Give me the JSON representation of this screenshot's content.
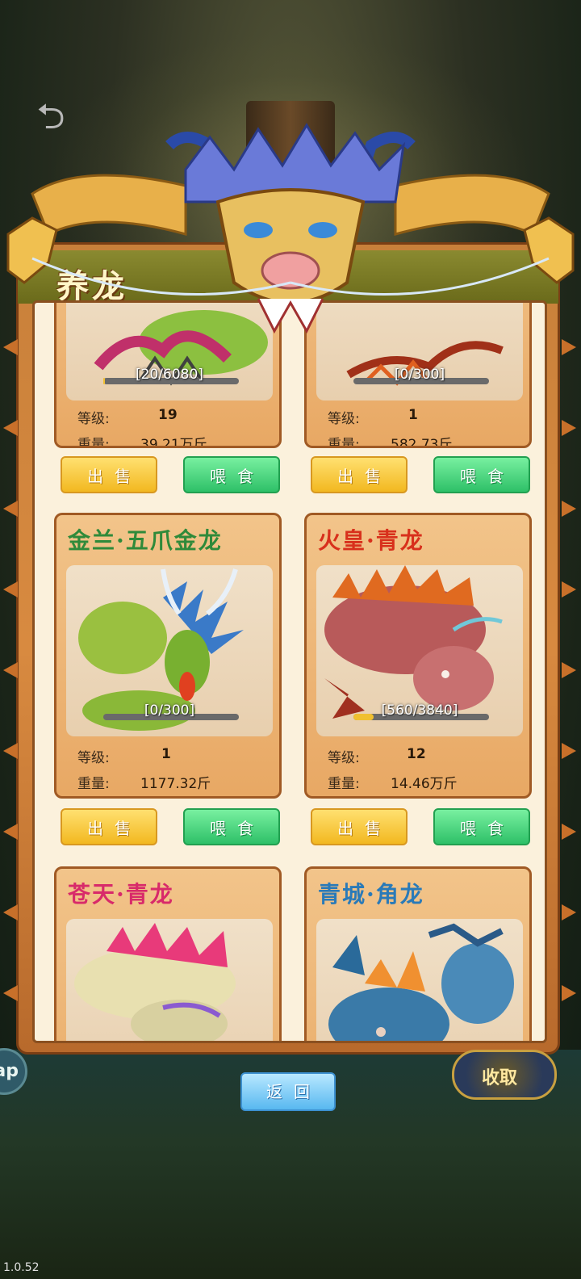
{
  "header": {
    "back_icon": "back-arrow-icon",
    "title": "养龙"
  },
  "cards": [
    {
      "name": "",
      "progress_text": "[20/6080]",
      "progress": 0.003,
      "level_label": "等级:",
      "level": "19",
      "weight_label": "重量:",
      "weight": "39.21万斤"
    },
    {
      "name": "",
      "progress_text": "[0/300]",
      "progress": 0.0,
      "level_label": "等级:",
      "level": "1",
      "weight_label": "重量:",
      "weight": "582.73斤"
    },
    {
      "name": "金兰·五爪金龙",
      "name_color": "#2f8a3a",
      "progress_text": "[0/300]",
      "progress": 0.0,
      "level_label": "等级:",
      "level": "1",
      "weight_label": "重量:",
      "weight": "1177.32斤"
    },
    {
      "name": "火皇·青龙",
      "name_color": "#d8301c",
      "progress_text": "[560/3840]",
      "progress": 0.146,
      "level_label": "等级:",
      "level": "12",
      "weight_label": "重量:",
      "weight": "14.46万斤"
    },
    {
      "name": "苍天·青龙",
      "name_color": "#d82a6a",
      "progress_text": "",
      "progress": 0.0,
      "level_label": "",
      "level": "",
      "weight_label": "",
      "weight": ""
    },
    {
      "name": "青城·角龙",
      "name_color": "#2a7ab8",
      "progress_text": "",
      "progress": 0.0,
      "level_label": "",
      "level": "",
      "weight_label": "",
      "weight": ""
    }
  ],
  "buttons": {
    "sell": "出售",
    "feed": "喂食",
    "return": "返回"
  },
  "side": {
    "left_badge": "ap",
    "right_badge": "收取"
  },
  "version": "1.0.52",
  "colors": {
    "sell": "#f2b820",
    "feed": "#2ec068",
    "return": "#58b8f0",
    "panel": "#d88a40"
  }
}
